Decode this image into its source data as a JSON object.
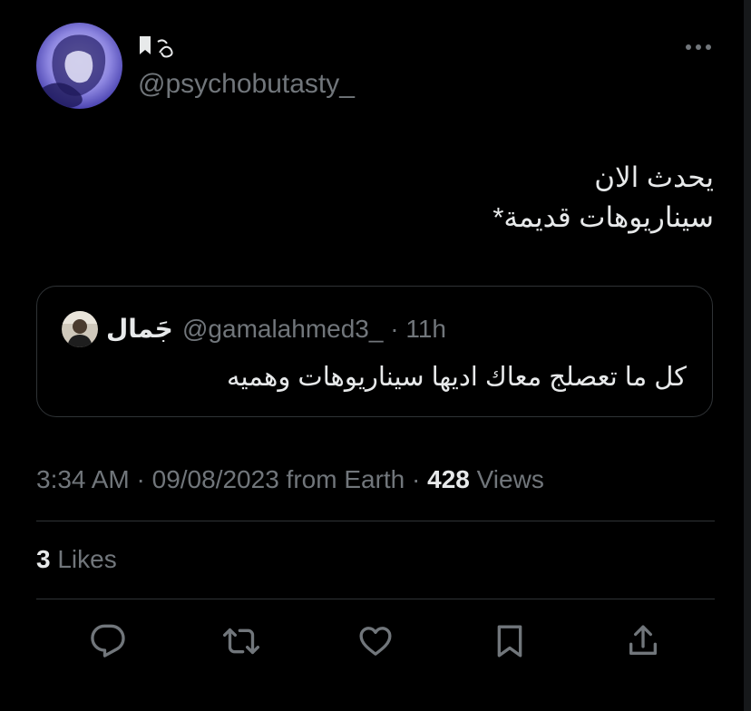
{
  "tweet": {
    "author": {
      "display_name": "🎀༄",
      "handle": "@psychobutasty_",
      "avatar_icon": "profile-photo"
    },
    "more_icon": "more-horizontal-icon",
    "text_lines": [
      "يحدث الان",
      "سيناريوهات قديمة*"
    ],
    "quoted": {
      "display_name": "جَمال",
      "handle": "@gamalahmed3_",
      "separator": "·",
      "time_ago": "11h",
      "text": "كل ما تعصلج معاك اديها سيناريوهات وهميه"
    },
    "meta": {
      "time": "3:34 AM",
      "date": "09/08/2023",
      "source": "from Earth",
      "separator": "·",
      "views_count": "428",
      "views_label": "Views"
    },
    "likes": {
      "count": "3",
      "label": "Likes"
    },
    "actions": [
      {
        "name": "reply",
        "icon": "reply-icon"
      },
      {
        "name": "retweet",
        "icon": "retweet-icon"
      },
      {
        "name": "like",
        "icon": "heart-icon"
      },
      {
        "name": "bookmark",
        "icon": "bookmark-icon"
      },
      {
        "name": "share",
        "icon": "share-icon"
      }
    ]
  },
  "colors": {
    "background": "#000000",
    "text_primary": "#e7e9ea",
    "text_secondary": "#71767b",
    "border": "#2f3336",
    "icon": "#71767b"
  }
}
